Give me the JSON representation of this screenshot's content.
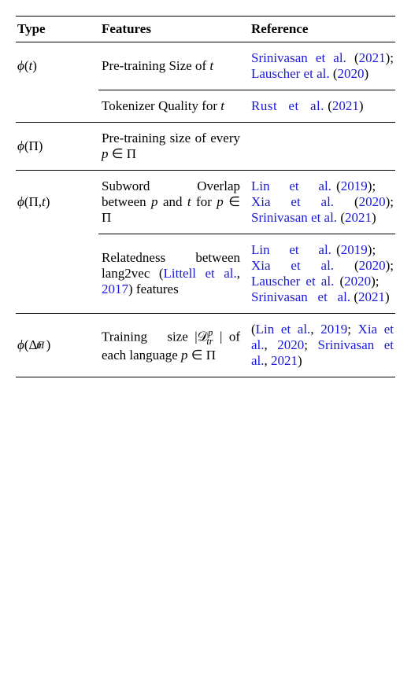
{
  "headers": {
    "type": "Type",
    "features": "Features",
    "reference": "Reference"
  },
  "rows": {
    "r1": {
      "type_html": "<span class='math'>ϕ</span>(<span class='math'>t</span>)",
      "feat1": "Pre-training Size of <span class='math'>t</span>",
      "ref1": "<span class='cite'>Srinivasan et al.</span> <span class='black'>(</span><span class='cite'>2021</span><span class='black'>);</span> <span class='cite'>Lauscher et al.</span> <span class='black'>(</span><span class='cite'>2020</span><span class='black'>)</span>",
      "feat2": "Tokenizer Quality for <span class='math'>t</span>",
      "ref2": "<span class='cite ws'>Rust &nbsp; et &nbsp; al.</span> <span class='black'>(</span><span class='cite'>2021</span><span class='black'>)</span>"
    },
    "r2": {
      "type_html": "<span class='math'>ϕ</span>(Π)",
      "feat": "Pre-training size of every <span class='math'>p</span> ∈ Π",
      "ref": ""
    },
    "r3": {
      "type_html": "<span class='math'>ϕ</span>(Π, <span class='math'>t</span>)",
      "feat1": "Subword Overlap between <span class='math'>p</span> and <span class='math'>t</span> for <span class='math'>p</span> ∈ Π",
      "ref1": "<span class='cite'>Lin &nbsp;&nbsp; et &nbsp;&nbsp; al.</span> <span class='black'>(</span><span class='cite'>2019</span><span class='black'>);</span> &nbsp;&nbsp;&nbsp; <span class='cite'>Xia et al.</span> <span class='black'>(</span><span class='cite'>2020</span><span class='black'>);</span> <span class='cite'>Srinivasan et al.</span> <span class='black'>(</span><span class='cite'>2021</span><span class='black'>)</span>",
      "feat2": "Relatedness between lang2vec (<span class='cite'>Littell et al.</span><span class='black'>,</span> <span class='cite'>2017</span>) features",
      "ref2": "<span class='cite'>Lin &nbsp;&nbsp; et &nbsp;&nbsp; al.</span> <span class='black'>(</span><span class='cite'>2019</span><span class='black'>);</span> &nbsp;&nbsp;&nbsp; <span class='cite'>Xia et al.</span> <span class='black'>(</span><span class='cite'>2020</span><span class='black'>);</span> <span class='cite'>Lauscher et al.</span> <span class='black'>(</span><span class='cite'>2020</span><span class='black'>);</span> &nbsp;&nbsp; <span class='cite'>Srinivasan &nbsp; et &nbsp; al.</span> <span class='black'>(</span><span class='cite'>2021</span><span class='black'>)</span>"
    },
    "r4": {
      "type_html": "<span class='math'>ϕ</span>(Δ<span class='sup'>Π</span><span class='sub' style='margin-left:-10px;'>tr</span>&nbsp;)",
      "feat": "Training &nbsp; size |𝒟<span class='sup'>p</span><span class='sub' style='margin-left:-8px;'>tr</span>&nbsp;| of each language <span class='math'>p</span> ∈ Π",
      "ref": "<span class='black'>(</span><span class='cite'>Lin et al.</span><span class='black'>,</span> <span class='cite'>2019</span><span class='black'>;</span> <span class='cite'>Xia et al.</span><span class='black'>,</span> <span class='cite'>2020</span><span class='black'>;</span> <span class='cite'>Srinivasan et al.</span><span class='black'>,</span> <span class='cite'>2021</span><span class='black'>)</span>"
    }
  }
}
